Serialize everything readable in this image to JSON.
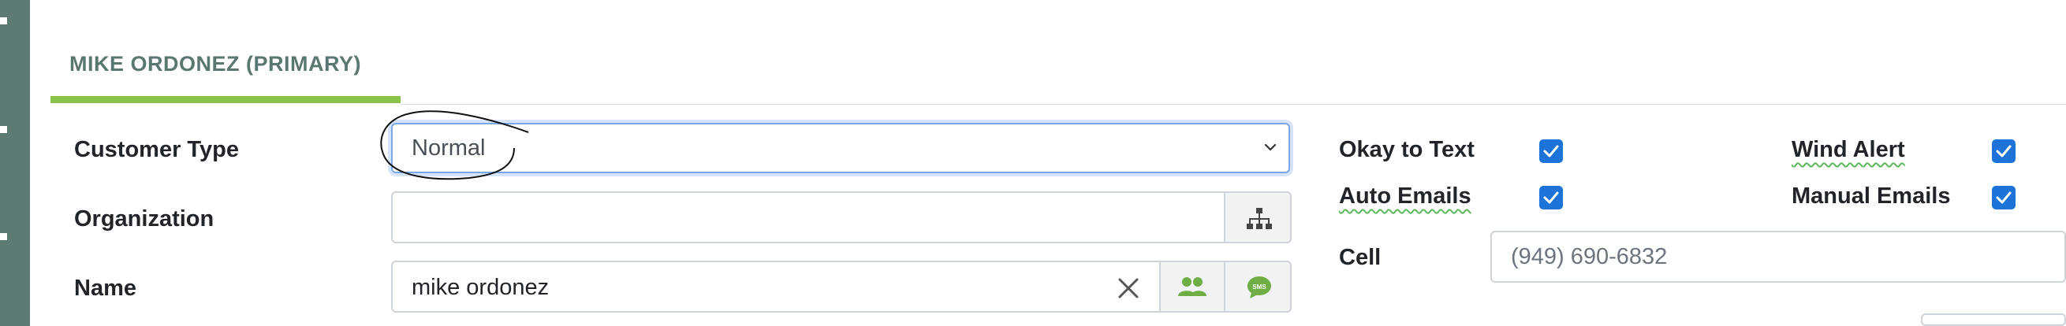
{
  "tab": {
    "title": "MIKE ORDONEZ (PRIMARY)"
  },
  "form": {
    "customer_type": {
      "label": "Customer Type",
      "value": "Normal"
    },
    "organization": {
      "label": "Organization",
      "value": ""
    },
    "name": {
      "label": "Name",
      "value": "mike ordonez"
    }
  },
  "options": {
    "okay_to_text": {
      "label": "Okay to Text",
      "checked": true
    },
    "wind_alert": {
      "label": "Wind Alert",
      "checked": true
    },
    "auto_emails": {
      "label": "Auto Emails",
      "checked": true
    },
    "manual_emails": {
      "label": "Manual Emails",
      "checked": true
    }
  },
  "contact": {
    "cell": {
      "label": "Cell",
      "value": "(949) 690-6832"
    }
  },
  "icons": {
    "org": "org-chart-icon",
    "clear": "close-icon",
    "contacts": "people-icon",
    "sms": "sms-icon",
    "caret": "chevron-down-icon"
  },
  "colors": {
    "accent_green": "#8bc34a",
    "checkbox_blue": "#1e73d8",
    "rail": "#5d7a75",
    "tab_text": "#5b7772"
  }
}
